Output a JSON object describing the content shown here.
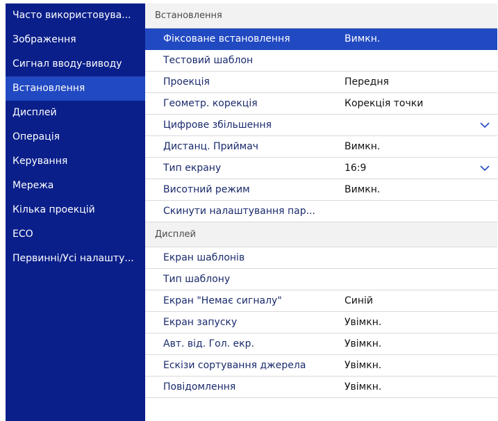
{
  "sidebar": {
    "items": [
      {
        "label": "Часто використовува..."
      },
      {
        "label": "Зображення"
      },
      {
        "label": "Сигнал вводу-виводу"
      },
      {
        "label": "Встановлення"
      },
      {
        "label": "Дисплей"
      },
      {
        "label": "Операція"
      },
      {
        "label": "Керування"
      },
      {
        "label": "Мережа"
      },
      {
        "label": "Кілька проекцій"
      },
      {
        "label": "ECO"
      },
      {
        "label": "Первинні/Усі налашту..."
      }
    ],
    "active_index": 3
  },
  "sections": [
    {
      "header": "Встановлення",
      "rows": [
        {
          "label": "Фіксоване встановлення",
          "value": "Вимкн.",
          "selected": true
        },
        {
          "label": "Тестовий шаблон",
          "value": ""
        },
        {
          "label": "Проекція",
          "value": "Передня"
        },
        {
          "label": "Геометр. корекція",
          "value": "Корекція точки"
        },
        {
          "label": "Цифрове збільшення",
          "value": "",
          "icon": "chevron-down-icon"
        },
        {
          "label": "Дистанц. Приймач",
          "value": "Вимкн."
        },
        {
          "label": "Тип екрану",
          "value": "16:9",
          "icon": "chevron-down-icon"
        },
        {
          "label": "Висотний режим",
          "value": "Вимкн."
        },
        {
          "label": "Скинути налаштування пар...",
          "value": ""
        }
      ]
    },
    {
      "header": "Дисплей",
      "rows": [
        {
          "label": "Екран шаблонів",
          "value": ""
        },
        {
          "label": "Тип шаблону",
          "value": ""
        },
        {
          "label": "Екран \"Немає сигналу\"",
          "value": "Синій"
        },
        {
          "label": "Екран запуску",
          "value": "Увімкн."
        },
        {
          "label": "Авт. від. Гол. екр.",
          "value": "Увімкн."
        },
        {
          "label": "Ескізи сортування джерела",
          "value": "Увімкн."
        },
        {
          "label": "Повідомлення",
          "value": "Увімкн."
        }
      ]
    }
  ],
  "colors": {
    "sidebar_bg": "#0a1f8a",
    "highlight": "#2149c2",
    "menu_text": "#1a2a6c"
  }
}
